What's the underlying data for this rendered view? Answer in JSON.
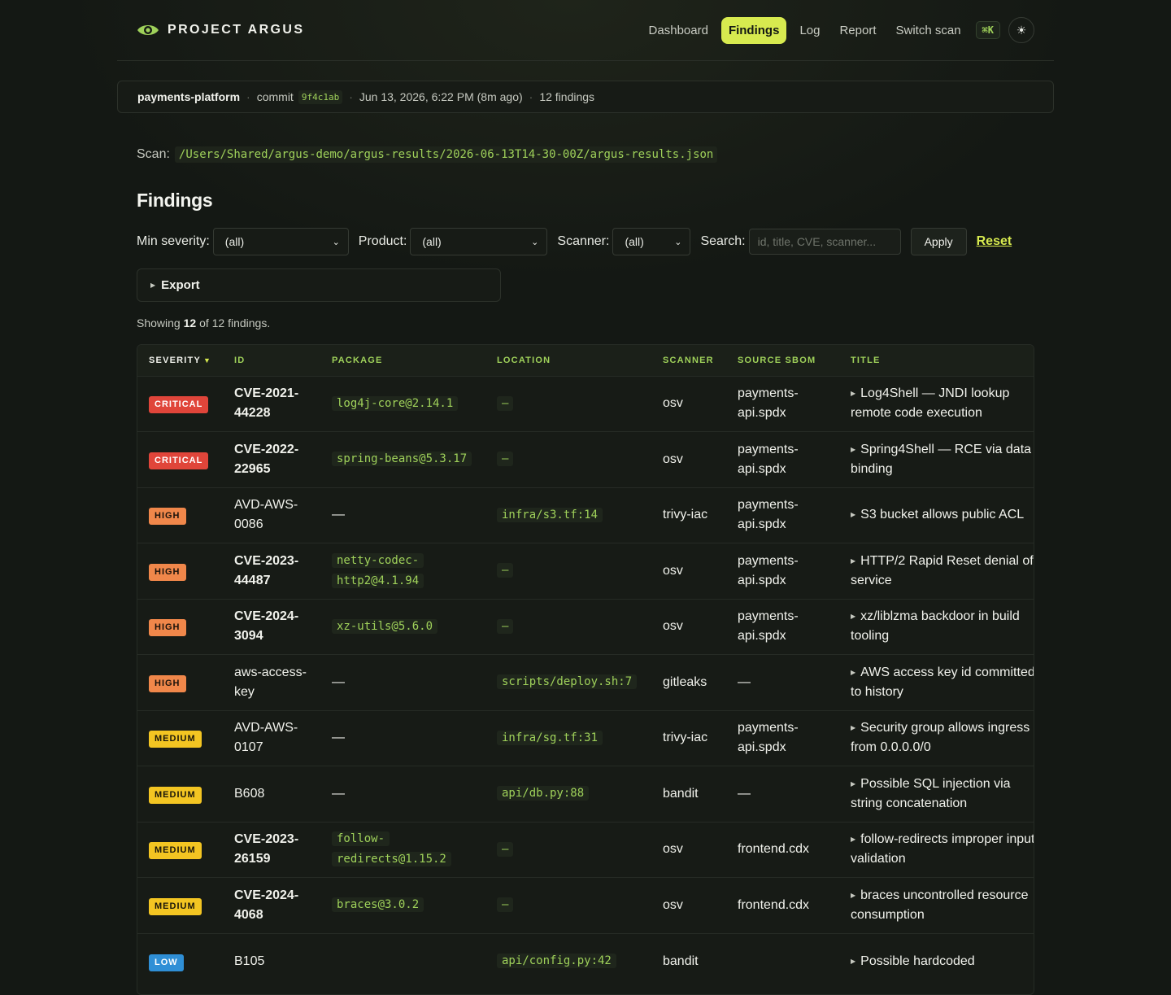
{
  "app": {
    "brand": "PROJECT ARGUS",
    "nav": [
      {
        "label": "Dashboard",
        "active": false
      },
      {
        "label": "Findings",
        "active": true
      },
      {
        "label": "Log",
        "active": false
      },
      {
        "label": "Report",
        "active": false
      },
      {
        "label": "Switch scan",
        "active": false
      }
    ],
    "shortcut": "⌘K",
    "theme_icon": "sun-icon",
    "accent": "#d7ea4f"
  },
  "meta": {
    "repo": "payments-platform",
    "commit_label": "commit",
    "commit_hash": "9f4c1ab",
    "timestamp": "Jun 13, 2026, 6:22 PM (8m ago)",
    "findings_count": "12 findings"
  },
  "scan": {
    "label": "Scan:",
    "path": "/Users/Shared/argus-demo/argus-results/2026-06-13T14-30-00Z/argus-results.json"
  },
  "page_title": "Findings",
  "filters": {
    "min_severity_label": "Min severity:",
    "min_severity_value": "(all)",
    "product_label": "Product:",
    "product_value": "(all)",
    "scanner_label": "Scanner:",
    "scanner_value": "(all)",
    "search_label": "Search:",
    "search_placeholder": "id, title, CVE, scanner...",
    "apply_label": "Apply",
    "reset_label": "Reset"
  },
  "export_label": "Export",
  "showing": {
    "prefix": "Showing",
    "shown": "12",
    "middle": "of 12 findings."
  },
  "table": {
    "columns": [
      "SEVERITY",
      "ID",
      "PACKAGE",
      "LOCATION",
      "SCANNER",
      "SOURCE SBOM",
      "TITLE"
    ],
    "severity_colors": {
      "CRITICAL": "#e0453a",
      "HIGH": "#f0874a",
      "MEDIUM": "#f3c522",
      "LOW": "#2f8fd6"
    },
    "rows": [
      {
        "severity": "CRITICAL",
        "id": "CVE-2021-44228",
        "package": "log4j-core@2.14.1",
        "location": "—",
        "scanner": "osv",
        "sbom": "payments-api.spdx",
        "title": "Log4Shell — JNDI lookup remote code execution"
      },
      {
        "severity": "CRITICAL",
        "id": "CVE-2022-22965",
        "package": "spring-beans@5.3.17",
        "location": "—",
        "scanner": "osv",
        "sbom": "payments-api.spdx",
        "title": "Spring4Shell — RCE via data binding"
      },
      {
        "severity": "HIGH",
        "id": "AVD-AWS-0086",
        "package": "—",
        "location": "infra/s3.tf:14",
        "scanner": "trivy-iac",
        "sbom": "payments-api.spdx",
        "title": "S3 bucket allows public ACL"
      },
      {
        "severity": "HIGH",
        "id": "CVE-2023-44487",
        "package": "netty-codec-http2@4.1.94",
        "location": "—",
        "scanner": "osv",
        "sbom": "payments-api.spdx",
        "title": "HTTP/2 Rapid Reset denial of service"
      },
      {
        "severity": "HIGH",
        "id": "CVE-2024-3094",
        "package": "xz-utils@5.6.0",
        "location": "—",
        "scanner": "osv",
        "sbom": "payments-api.spdx",
        "title": "xz/liblzma backdoor in build tooling"
      },
      {
        "severity": "HIGH",
        "id": "aws-access-key",
        "package": "—",
        "location": "scripts/deploy.sh:7",
        "scanner": "gitleaks",
        "sbom": "—",
        "title": "AWS access key id committed to history"
      },
      {
        "severity": "MEDIUM",
        "id": "AVD-AWS-0107",
        "package": "—",
        "location": "infra/sg.tf:31",
        "scanner": "trivy-iac",
        "sbom": "payments-api.spdx",
        "title": "Security group allows ingress from 0.0.0.0/0"
      },
      {
        "severity": "MEDIUM",
        "id": "B608",
        "package": "—",
        "location": "api/db.py:88",
        "scanner": "bandit",
        "sbom": "—",
        "title": "Possible SQL injection via string concatenation"
      },
      {
        "severity": "MEDIUM",
        "id": "CVE-2023-26159",
        "package": "follow-redirects@1.15.2",
        "location": "—",
        "scanner": "osv",
        "sbom": "frontend.cdx",
        "title": "follow-redirects improper input validation"
      },
      {
        "severity": "MEDIUM",
        "id": "CVE-2024-4068",
        "package": "braces@3.0.2",
        "location": "—",
        "scanner": "osv",
        "sbom": "frontend.cdx",
        "title": "braces uncontrolled resource consumption"
      },
      {
        "severity": "LOW",
        "id": "B105",
        "package": "",
        "location": "api/config.py:42",
        "scanner": "bandit",
        "sbom": "",
        "title": "Possible hardcoded"
      }
    ]
  }
}
